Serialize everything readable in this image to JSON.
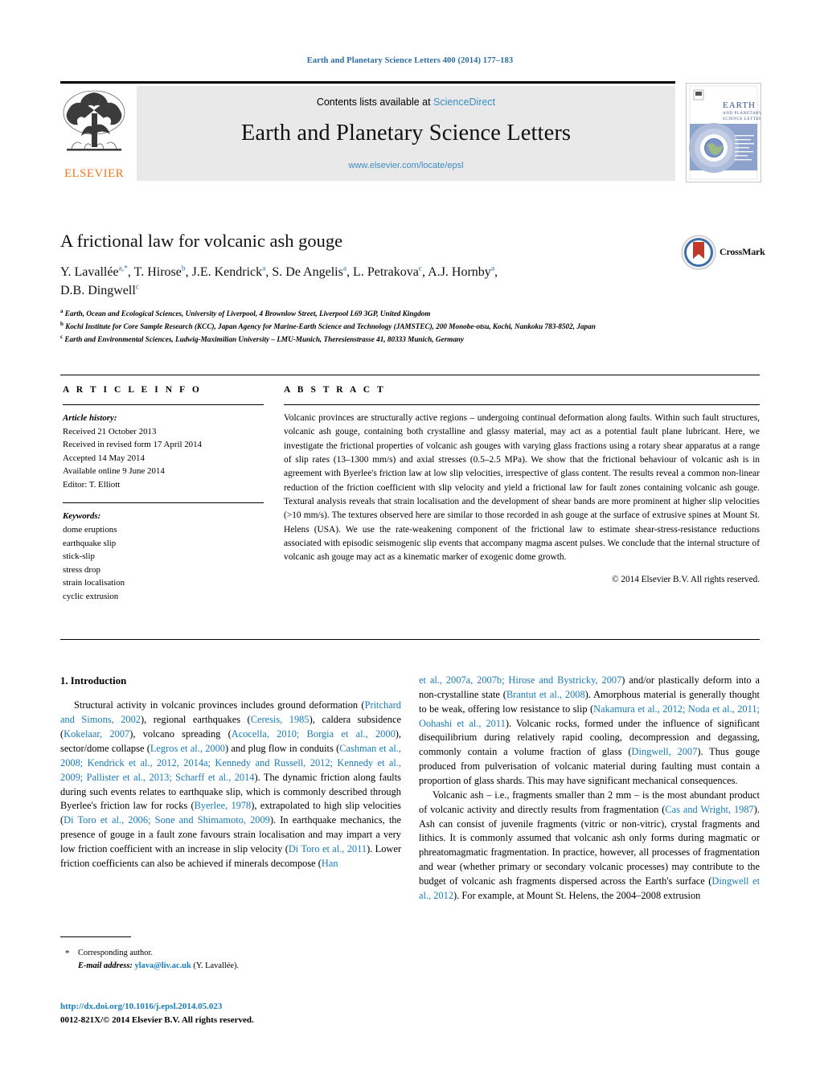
{
  "running_head": "Earth and Planetary Science Letters 400 (2014) 177–183",
  "masthead": {
    "contents_text": "Contents lists available at ",
    "sciencedirect": "ScienceDirect",
    "journal_name": "Earth and Planetary Science Letters",
    "journal_url": "www.elsevier.com/locate/epsl",
    "publisher": "ELSEVIER",
    "cover_title_line1": "EARTH",
    "cover_title_line2": "AND PLANETARY",
    "cover_title_line3": "SCIENCE LETTERS"
  },
  "article": {
    "title": "A frictional law for volcanic ash gouge",
    "authors_line1_parts": [
      {
        "name": "Y. Lavallée",
        "sup": "a,*"
      },
      {
        "name": "T. Hirose",
        "sup": "b"
      },
      {
        "name": "J.E. Kendrick",
        "sup": "a"
      },
      {
        "name": "S. De Angelis",
        "sup": "a"
      },
      {
        "name": "L. Petrakova",
        "sup": "c"
      },
      {
        "name": "A.J. Hornby",
        "sup": "a"
      }
    ],
    "authors_line2_parts": [
      {
        "name": "D.B. Dingwell",
        "sup": "c"
      }
    ],
    "crossmark_label": "CrossMark",
    "affiliations": [
      {
        "mark": "a",
        "text": "Earth, Ocean and Ecological Sciences, University of Liverpool, 4 Brownlow Street, Liverpool L69 3GP, United Kingdom"
      },
      {
        "mark": "b",
        "text": "Kochi Institute for Core Sample Research (KCC), Japan Agency for Marine-Earth Science and Technology (JAMSTEC), 200 Monobe-otsu, Kochi, Nankoku 783-8502, Japan"
      },
      {
        "mark": "c",
        "text": "Earth and Environmental Sciences, Ludwig-Maximilian University – LMU-Munich, Theresienstrasse 41, 80333 Munich, Germany"
      }
    ]
  },
  "article_info": {
    "heading": "A R T I C L E   I N F O",
    "history_label": "Article history:",
    "history": [
      "Received 21 October 2013",
      "Received in revised form 17 April 2014",
      "Accepted 14 May 2014",
      "Available online 9 June 2014",
      "Editor: T. Elliott"
    ],
    "keywords_label": "Keywords:",
    "keywords": [
      "dome eruptions",
      "earthquake slip",
      "stick-slip",
      "stress drop",
      "strain localisation",
      "cyclic extrusion"
    ]
  },
  "abstract": {
    "heading": "A B S T R A C T",
    "text": "Volcanic provinces are structurally active regions – undergoing continual deformation along faults. Within such fault structures, volcanic ash gouge, containing both crystalline and glassy material, may act as a potential fault plane lubricant. Here, we investigate the frictional properties of volcanic ash gouges with varying glass fractions using a rotary shear apparatus at a range of slip rates (13–1300 mm/s) and axial stresses (0.5–2.5 MPa). We show that the frictional behaviour of volcanic ash is in agreement with Byerlee's friction law at low slip velocities, irrespective of glass content. The results reveal a common non-linear reduction of the friction coefficient with slip velocity and yield a frictional law for fault zones containing volcanic ash gouge. Textural analysis reveals that strain localisation and the development of shear bands are more prominent at higher slip velocities (>10 mm/s). The textures observed here are similar to those recorded in ash gouge at the surface of extrusive spines at Mount St. Helens (USA). We use the rate-weakening component of the frictional law to estimate shear-stress-resistance reductions associated with episodic seismogenic slip events that accompany magma ascent pulses. We conclude that the internal structure of volcanic ash gouge may act as a kinematic marker of exogenic dome growth.",
    "copyright": "© 2014 Elsevier B.V. All rights reserved."
  },
  "body": {
    "section_heading": "1. Introduction",
    "left_paragraph_html": "Structural activity in volcanic provinces includes ground deformation (<span class=\"ref\">Pritchard and Simons, 2002</span>), regional earthquakes (<span class=\"ref\">Ceresis, 1985</span>), caldera subsidence (<span class=\"ref\">Kokelaar, 2007</span>), volcano spreading (<span class=\"ref\">Acocella, 2010; Borgia et al., 2000</span>), sector/dome collapse (<span class=\"ref\">Legros et al., 2000</span>) and plug flow in conduits (<span class=\"ref\">Cashman et al., 2008; Kendrick et al., 2012, 2014a; Kennedy and Russell, 2012; Kennedy et al., 2009; Pallister et al., 2013; Scharff et al., 2014</span>). The dynamic friction along faults during such events relates to earthquake slip, which is commonly described through Byerlee's friction law for rocks (<span class=\"ref\">Byerlee, 1978</span>), extrapolated to high slip velocities (<span class=\"ref\">Di Toro et al., 2006; Sone and Shimamoto, 2009</span>). In earthquake mechanics, the presence of gouge in a fault zone favours strain localisation and may impart a very low friction coefficient with an increase in slip velocity (<span class=\"ref\">Di Toro et al., 2011</span>). Lower friction coefficients can also be achieved if minerals decompose (<span class=\"ref\">Han</span>",
    "right_paragraph1_html": "<span class=\"ref\">et al., 2007a, 2007b; Hirose and Bystricky, 2007</span>) and/or plastically deform into a non-crystalline state (<span class=\"ref\">Brantut et al., 2008</span>). Amorphous material is generally thought to be weak, offering low resistance to slip (<span class=\"ref\">Nakamura et al., 2012; Noda et al., 2011; Oohashi et al., 2011</span>). Volcanic rocks, formed under the influence of significant disequilibrium during relatively rapid cooling, decompression and degassing, commonly contain a volume fraction of glass (<span class=\"ref\">Dingwell, 2007</span>). Thus gouge produced from pulverisation of volcanic material during faulting must contain a proportion of glass shards. This may have significant mechanical consequences.",
    "right_paragraph2_html": "Volcanic ash – i.e., fragments smaller than 2 mm – is the most abundant product of volcanic activity and directly results from fragmentation (<span class=\"ref\">Cas and Wright, 1987</span>). Ash can consist of juvenile fragments (vitric or non-vitric), crystal fragments and lithics. It is commonly assumed that volcanic ash only forms during magmatic or phreatomagmatic fragmentation. In practice, however, all processes of fragmentation and wear (whether primary or secondary volcanic processes) may contribute to the budget of volcanic ash fragments dispersed across the Earth's surface (<span class=\"ref\">Dingwell et al., 2012</span>). For example, at Mount St. Helens, the 2004–2008 extrusion"
  },
  "footer": {
    "corresponding_star": "*",
    "corresponding_label": "Corresponding author.",
    "email_label": "E-mail address:",
    "email": "ylava@liv.ac.uk",
    "email_owner": "(Y. Lavallée).",
    "doi": "http://dx.doi.org/10.1016/j.epsl.2014.05.023",
    "issn_line": "0012-821X/© 2014 Elsevier B.V. All rights reserved."
  },
  "colors": {
    "link_blue": "#1a7cb8",
    "header_blue": "#2b6ca3",
    "elsevier_orange": "#F47920",
    "band_gray": "#e9e9e9"
  }
}
